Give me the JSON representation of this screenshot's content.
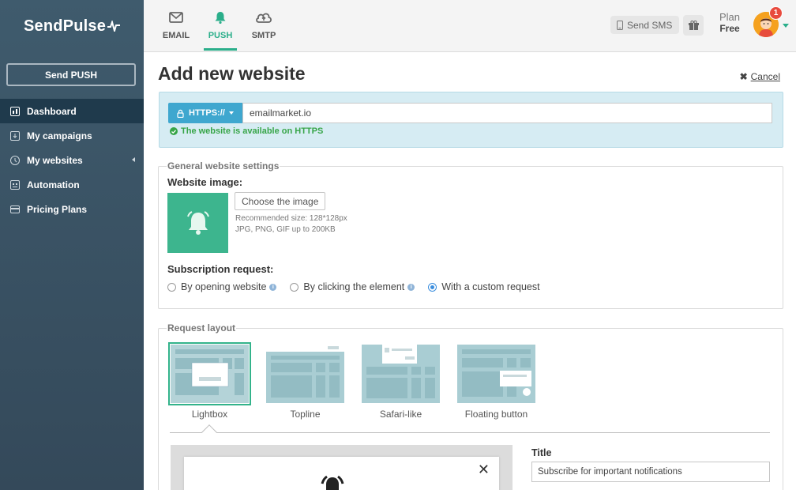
{
  "brand": {
    "name": "SendPulse"
  },
  "sidebar": {
    "send_push_label": "Send PUSH",
    "items": [
      {
        "label": "Dashboard",
        "icon": "dashboard-icon",
        "active": true
      },
      {
        "label": "My campaigns",
        "icon": "campaigns-icon"
      },
      {
        "label": "My websites",
        "icon": "websites-icon"
      },
      {
        "label": "Automation",
        "icon": "automation-icon"
      },
      {
        "label": "Pricing Plans",
        "icon": "pricing-icon"
      }
    ]
  },
  "topbar": {
    "tabs": [
      {
        "label": "EMAIL",
        "icon": "envelope-icon"
      },
      {
        "label": "PUSH",
        "icon": "bell-icon",
        "active": true
      },
      {
        "label": "SMTP",
        "icon": "cloud-upload-icon"
      }
    ],
    "send_sms_label": "Send SMS",
    "plan_label": "Plan",
    "plan_value": "Free",
    "notification_count": "1"
  },
  "page": {
    "title": "Add new website",
    "cancel_label": "Cancel",
    "protocol_label": "HTTPS://",
    "url_value": "emailmarket.io",
    "https_status": "The website is available on HTTPS"
  },
  "general_settings": {
    "legend": "General website settings",
    "image_label": "Website image:",
    "choose_image_label": "Choose the image",
    "recommended_size": "Recommended size: 128*128px",
    "formats": "JPG, PNG, GIF up to 200KB",
    "subscription_label": "Subscription request:",
    "options": [
      {
        "label": "By opening website",
        "info": true
      },
      {
        "label": "By clicking the element",
        "info": true
      },
      {
        "label": "With a custom request",
        "checked": true
      }
    ]
  },
  "request_layout": {
    "legend": "Request layout",
    "options": [
      {
        "label": "Lightbox",
        "selected": true
      },
      {
        "label": "Topline"
      },
      {
        "label": "Safari-like"
      },
      {
        "label": "Floating button"
      }
    ],
    "title_label": "Title",
    "title_value": "Subscribe for important notifications"
  },
  "colors": {
    "accent": "#2aae8a",
    "sidebar": "#3f5b6d",
    "info_box": "#d6ecf3",
    "https_ok": "#37a548"
  }
}
